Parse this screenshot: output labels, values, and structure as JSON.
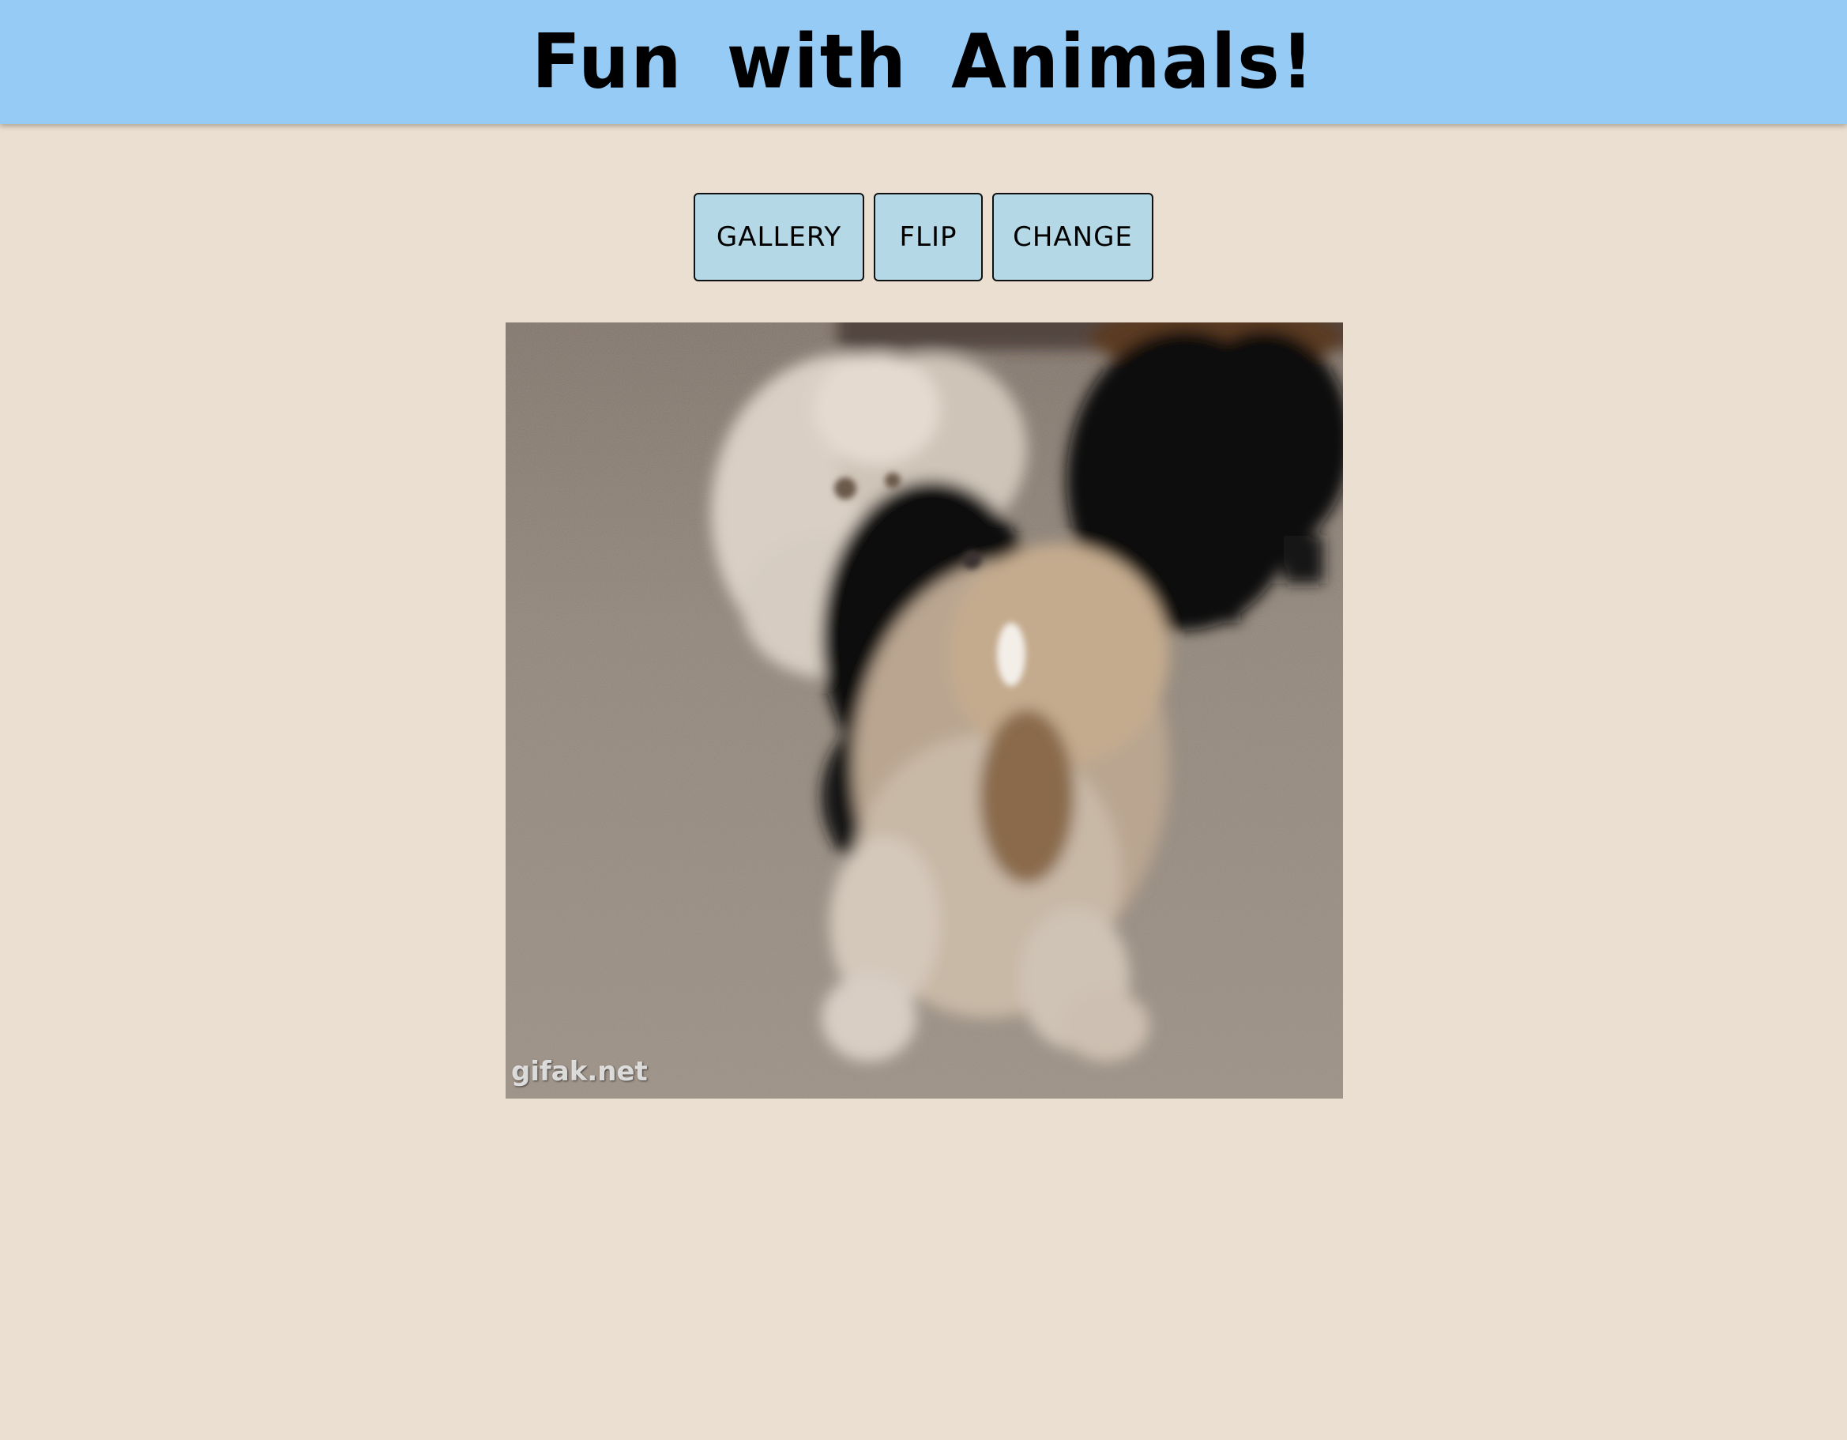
{
  "header": {
    "title": "Fun with Animals!",
    "background_color": "#96cbf6"
  },
  "controls": {
    "gallery_label": "GALLERY",
    "flip_label": "FLIP",
    "change_label": "CHANGE",
    "button_color": "#b4d8e5"
  },
  "image": {
    "watermark": "gifak.net"
  },
  "page": {
    "background_color": "#eadfd0"
  }
}
